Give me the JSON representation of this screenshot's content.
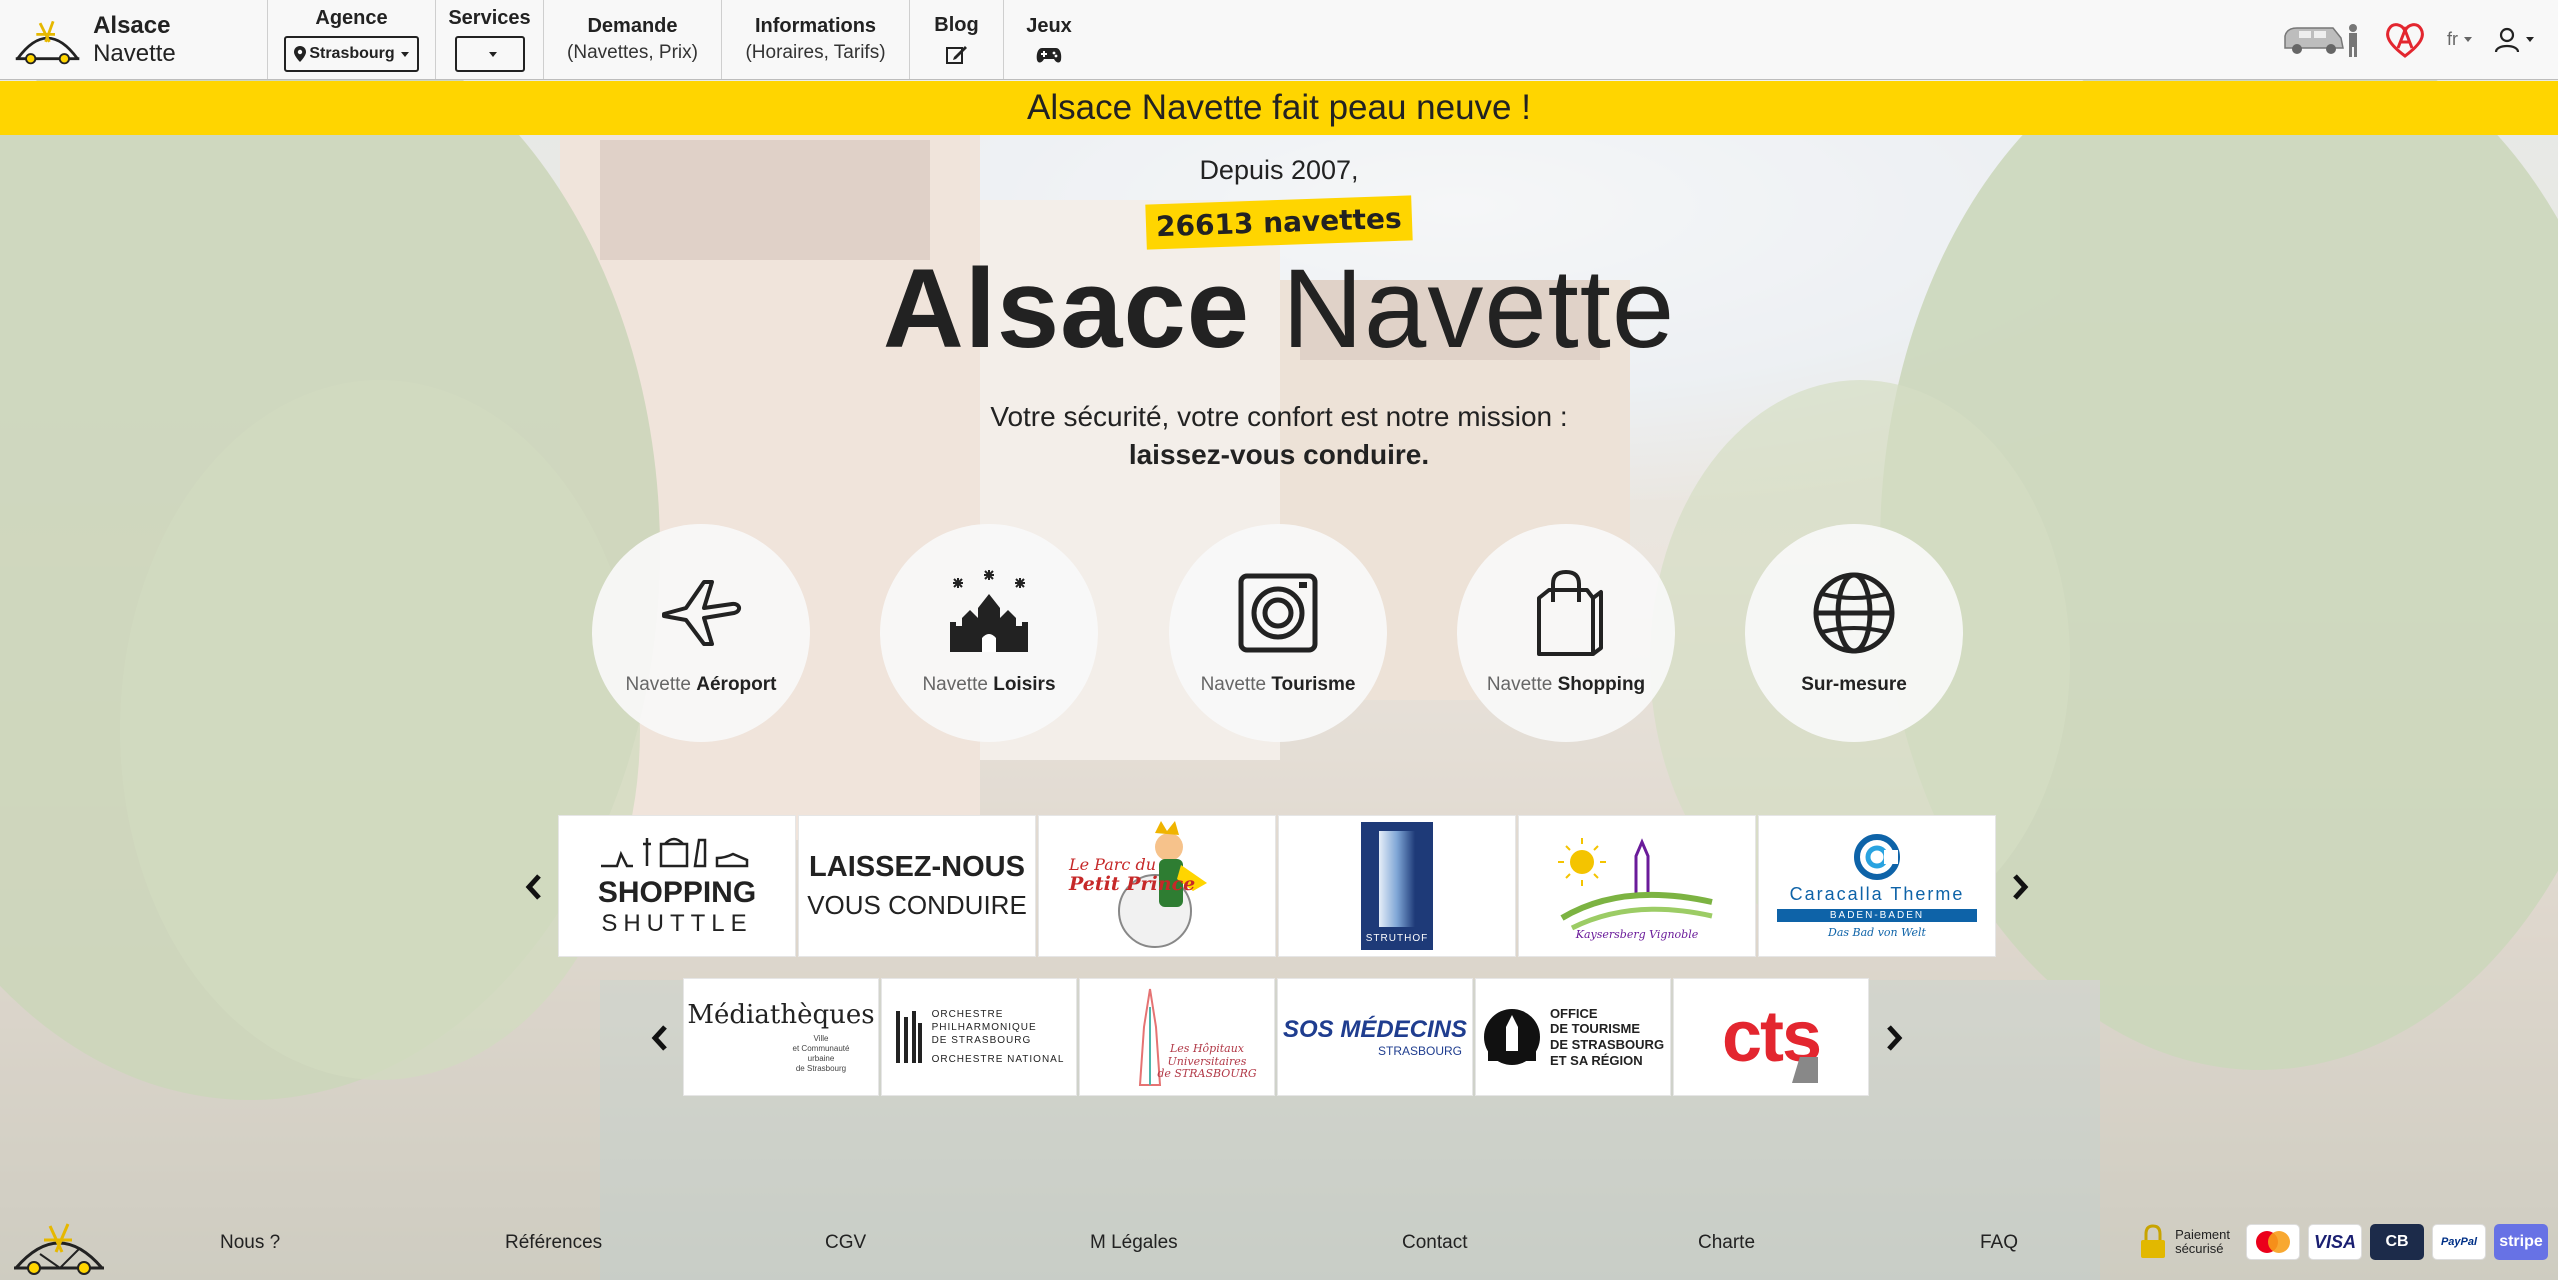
{
  "brand": {
    "name_bold": "Alsace",
    "name_rest": " Navette"
  },
  "nav": {
    "agence": {
      "title": "Agence",
      "value": "Strasbourg"
    },
    "services": {
      "title": "Services",
      "value": ""
    },
    "demande": {
      "title": "Demande",
      "sub": "(Navettes, Prix)"
    },
    "informations": {
      "title": "Informations",
      "sub": "(Horaires, Tarifs)"
    },
    "blog": {
      "title": "Blog"
    },
    "jeux": {
      "title": "Jeux"
    },
    "lang": "fr"
  },
  "banner": {
    "text": "Alsace Navette fait peau neuve !"
  },
  "hero": {
    "since": "Depuis 2007,",
    "counter": "26613 navettes",
    "title_bold": "Alsace",
    "title_rest": "Navette",
    "tagline1": "Votre sécurité, votre confort est notre mission :",
    "tagline2": "laissez-vous conduire."
  },
  "services": [
    {
      "pre": "Navette",
      "bold": "Aéroport",
      "icon": "airplane-icon"
    },
    {
      "pre": "Navette",
      "bold": "Loisirs",
      "icon": "castle-fireworks-icon"
    },
    {
      "pre": "Navette",
      "bold": "Tourisme",
      "icon": "camera-icon"
    },
    {
      "pre": "Navette",
      "bold": "Shopping",
      "icon": "shopping-bag-icon"
    },
    {
      "pre": "",
      "bold": "Sur-mesure",
      "icon": "globe-icon"
    }
  ],
  "partners_row1": {
    "shopping_shuttle": {
      "line1": "SHOPPING",
      "line2": "SHUTTLE"
    },
    "laissez": {
      "line1": "LAISSEZ-NOUS",
      "line2": "VOUS CONDUIRE"
    },
    "petit_prince": {
      "line1": "Le Parc du",
      "line2": "Petit Prince"
    },
    "struthof": {
      "text": "STRUTHOF"
    },
    "kaysersberg": {
      "text": "Kaysersberg Vignoble"
    },
    "caracalla": {
      "line1": "Caracalla Therme",
      "line2": "BADEN-BADEN",
      "line3": "Das Bad von Welt"
    }
  },
  "partners_row2": {
    "mediatheques": {
      "title": "Médiathèques",
      "sub1": "Ville",
      "sub2": "et Communauté",
      "sub3": "urbaine",
      "sub4": "de Strasbourg"
    },
    "orchestre": {
      "line1": "ORCHESTRE",
      "line2": "PHILHARMONIQUE",
      "line3": "DE STRASBOURG",
      "line4": "ORCHESTRE NATIONAL"
    },
    "hopitaux": {
      "line1": "Les Hôpitaux",
      "line2": "Universitaires",
      "line3": "de STRASBOURG"
    },
    "sos": {
      "line1": "SOS MÉDECINS",
      "line2": "STRASBOURG"
    },
    "office": {
      "line1": "OFFICE",
      "line2": "DE TOURISME",
      "line3": "DE STRASBOURG",
      "line4": "ET SA RÉGION"
    },
    "cts": {
      "text": "CTS"
    }
  },
  "footer": {
    "links": [
      "Nous ?",
      "Références",
      "CGV",
      "M Légales",
      "Contact",
      "Charte",
      "FAQ"
    ],
    "secure_line1": "Paiement",
    "secure_line2": "sécurisé",
    "cards": [
      "VISA",
      "CB",
      "PayPal",
      "stripe"
    ]
  },
  "colors": {
    "accent": "#ffd500",
    "text": "#222222",
    "cts_red": "#e3262f",
    "caracalla_blue": "#0e63a8"
  }
}
